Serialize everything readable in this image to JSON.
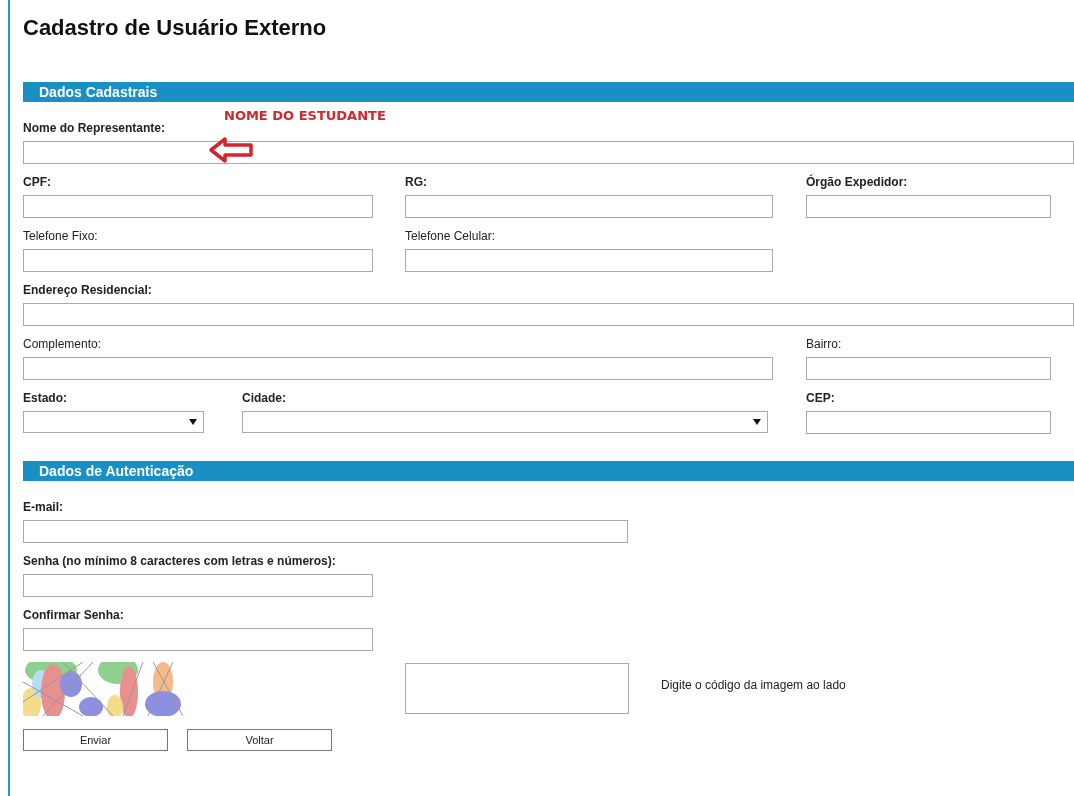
{
  "title": "Cadastro de Usuário Externo",
  "annotation": {
    "text": "NOME DO ESTUDANTE"
  },
  "sections": [
    {
      "heading": "Dados Cadastrais",
      "rows": [
        [
          {
            "label": "Nome do Representante:",
            "bold": true,
            "kind": "text"
          }
        ],
        [
          {
            "label": "CPF:",
            "bold": true,
            "kind": "text"
          },
          {
            "label": "RG:",
            "bold": true,
            "kind": "text"
          },
          {
            "label": "Órgão Expedidor:",
            "bold": true,
            "kind": "text"
          }
        ],
        [
          {
            "label": "Telefone Fixo:",
            "bold": false,
            "kind": "text"
          },
          {
            "label": "Telefone Celular:",
            "bold": false,
            "kind": "text"
          }
        ],
        [
          {
            "label": "Endereço Residencial:",
            "bold": true,
            "kind": "text"
          }
        ],
        [
          {
            "label": "Complemento:",
            "bold": false,
            "kind": "text"
          },
          "",
          {
            "label": "Bairro:",
            "bold": false,
            "kind": "text"
          }
        ],
        [
          {
            "label": "Estado:",
            "bold": true,
            "kind": "select"
          },
          {
            "label": "Cidade:",
            "bold": true,
            "kind": "select"
          },
          {
            "label": "CEP:",
            "bold": true,
            "kind": "text"
          }
        ]
      ]
    },
    {
      "heading": "Dados de Autenticação",
      "rows": [
        [
          {
            "label": "E-mail:",
            "bold": true,
            "kind": "text"
          }
        ],
        [
          {
            "label": "Senha (no mínimo 8 caracteres com letras e números):",
            "bold": true,
            "kind": "text"
          }
        ],
        [
          {
            "label": "Confirmar Senha:",
            "bold": true,
            "kind": "text"
          }
        ]
      ]
    }
  ],
  "captcha": {
    "kind": "picture",
    "hint": "Digite o código da imagem ao lado"
  },
  "buttons": [
    "Enviar",
    "Voltar"
  ]
}
